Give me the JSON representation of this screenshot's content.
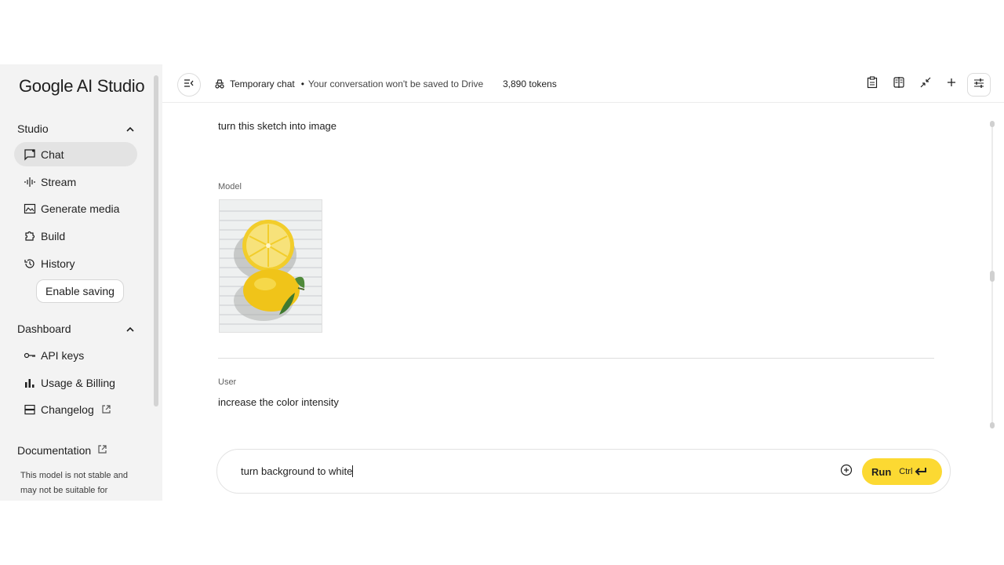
{
  "sidebar": {
    "logo": "Google AI Studio",
    "studio_label": "Studio",
    "studio_items": [
      {
        "label": "Chat",
        "icon": "chat-icon"
      },
      {
        "label": "Stream",
        "icon": "waveform-icon"
      },
      {
        "label": "Generate media",
        "icon": "image-icon"
      },
      {
        "label": "Build",
        "icon": "puzzle-icon"
      },
      {
        "label": "History",
        "icon": "history-icon"
      }
    ],
    "enable_saving": "Enable saving",
    "dashboard_label": "Dashboard",
    "dashboard_items": [
      {
        "label": "API keys",
        "icon": "key-icon"
      },
      {
        "label": "Usage & Billing",
        "icon": "bar-chart-icon"
      },
      {
        "label": "Changelog",
        "icon": "changelog-icon"
      }
    ],
    "documentation": "Documentation",
    "disclaimer": "This model is not stable and may not be suitable for"
  },
  "topbar": {
    "temporary_chat": "Temporary chat",
    "temporary_chat_note": "Your conversation won't be saved to Drive",
    "tokens": "3,890 tokens"
  },
  "chat": {
    "first_user_message": "turn this sketch into image",
    "model_role": "Model",
    "model_image_alt": "two lemons",
    "user_role": "User",
    "second_user_message": "increase the color intensity"
  },
  "composer": {
    "input_value": "turn background to white",
    "run_label": "Run",
    "shortcut": "Ctrl"
  },
  "colors": {
    "run_button": "#fcd932",
    "sidebar_bg": "#f3f3f3",
    "active_item_bg": "#e3e3e3"
  }
}
